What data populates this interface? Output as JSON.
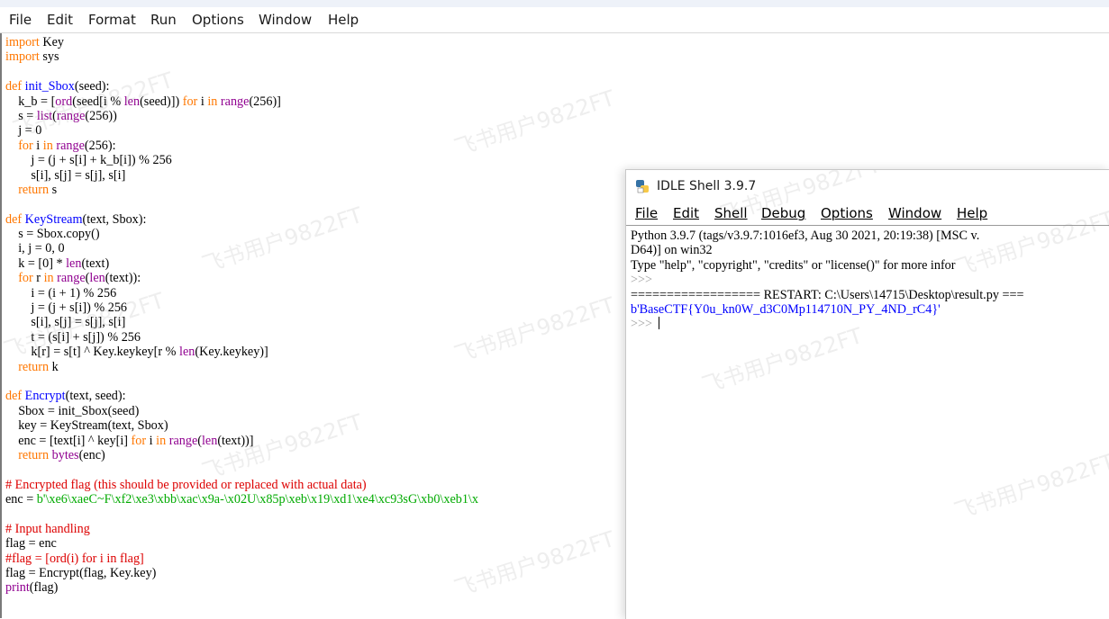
{
  "editor_menu": [
    "File",
    "Edit",
    "Format",
    "Run",
    "Options",
    "Window",
    "Help"
  ],
  "code_lines": [
    [
      [
        "kw",
        "import"
      ],
      [
        "p",
        " Key"
      ]
    ],
    [
      [
        "kw",
        "import"
      ],
      [
        "p",
        " sys"
      ]
    ],
    [],
    [
      [
        "kw",
        "def"
      ],
      [
        "p",
        " "
      ],
      [
        "fn",
        "init_Sbox"
      ],
      [
        "p",
        "(seed):"
      ]
    ],
    [
      [
        "p",
        "    k_b = ["
      ],
      [
        "bi",
        "ord"
      ],
      [
        "p",
        "(seed[i % "
      ],
      [
        "bi",
        "len"
      ],
      [
        "p",
        "(seed)]) "
      ],
      [
        "kw",
        "for"
      ],
      [
        "p",
        " i "
      ],
      [
        "kw",
        "in"
      ],
      [
        "p",
        " "
      ],
      [
        "bi",
        "range"
      ],
      [
        "p",
        "(256)]"
      ]
    ],
    [
      [
        "p",
        "    s = "
      ],
      [
        "bi",
        "list"
      ],
      [
        "p",
        "("
      ],
      [
        "bi",
        "range"
      ],
      [
        "p",
        "(256))"
      ]
    ],
    [
      [
        "p",
        "    j = 0"
      ]
    ],
    [
      [
        "p",
        "    "
      ],
      [
        "kw",
        "for"
      ],
      [
        "p",
        " i "
      ],
      [
        "kw",
        "in"
      ],
      [
        "p",
        " "
      ],
      [
        "bi",
        "range"
      ],
      [
        "p",
        "(256):"
      ]
    ],
    [
      [
        "p",
        "        j = (j + s[i] + k_b[i]) % 256"
      ]
    ],
    [
      [
        "p",
        "        s[i], s[j] = s[j], s[i]"
      ]
    ],
    [
      [
        "p",
        "    "
      ],
      [
        "kw",
        "return"
      ],
      [
        "p",
        " s"
      ]
    ],
    [],
    [
      [
        "kw",
        "def"
      ],
      [
        "p",
        " "
      ],
      [
        "fn",
        "KeyStream"
      ],
      [
        "p",
        "(text, Sbox):"
      ]
    ],
    [
      [
        "p",
        "    s = Sbox.copy()"
      ]
    ],
    [
      [
        "p",
        "    i, j = 0, 0"
      ]
    ],
    [
      [
        "p",
        "    k = [0] * "
      ],
      [
        "bi",
        "len"
      ],
      [
        "p",
        "(text)"
      ]
    ],
    [
      [
        "p",
        "    "
      ],
      [
        "kw",
        "for"
      ],
      [
        "p",
        " r "
      ],
      [
        "kw",
        "in"
      ],
      [
        "p",
        " "
      ],
      [
        "bi",
        "range"
      ],
      [
        "p",
        "("
      ],
      [
        "bi",
        "len"
      ],
      [
        "p",
        "(text)):"
      ]
    ],
    [
      [
        "p",
        "        i = (i + 1) % 256"
      ]
    ],
    [
      [
        "p",
        "        j = (j + s[i]) % 256"
      ]
    ],
    [
      [
        "p",
        "        s[i], s[j] = s[j], s[i]"
      ]
    ],
    [
      [
        "p",
        "        t = (s[i] + s[j]) % 256"
      ]
    ],
    [
      [
        "p",
        "        k[r] = s[t] ^ Key.keykey[r % "
      ],
      [
        "bi",
        "len"
      ],
      [
        "p",
        "(Key.keykey)]"
      ]
    ],
    [
      [
        "p",
        "    "
      ],
      [
        "kw",
        "return"
      ],
      [
        "p",
        " k"
      ]
    ],
    [],
    [
      [
        "kw",
        "def"
      ],
      [
        "p",
        " "
      ],
      [
        "fn",
        "Encrypt"
      ],
      [
        "p",
        "(text, seed):"
      ]
    ],
    [
      [
        "p",
        "    Sbox = init_Sbox(seed)"
      ]
    ],
    [
      [
        "p",
        "    key = KeyStream(text, Sbox)"
      ]
    ],
    [
      [
        "p",
        "    enc = [text[i] ^ key[i] "
      ],
      [
        "kw",
        "for"
      ],
      [
        "p",
        " i "
      ],
      [
        "kw",
        "in"
      ],
      [
        "p",
        " "
      ],
      [
        "bi",
        "range"
      ],
      [
        "p",
        "("
      ],
      [
        "bi",
        "len"
      ],
      [
        "p",
        "(text))]"
      ]
    ],
    [
      [
        "p",
        "    "
      ],
      [
        "kw",
        "return"
      ],
      [
        "p",
        " "
      ],
      [
        "bi",
        "bytes"
      ],
      [
        "p",
        "(enc)"
      ]
    ],
    [],
    [
      [
        "cm",
        "# Encrypted flag (this should be provided or replaced with actual data)"
      ]
    ],
    [
      [
        "p",
        "enc = "
      ],
      [
        "st",
        "b'\\xe6\\xaeC~F\\xf2\\xe3\\xbb\\xac\\x9a-\\x02U\\x85p\\xeb\\x19\\xd1\\xe4\\xc93sG\\xb0\\xeb1\\x"
      ]
    ],
    [],
    [
      [
        "cm",
        "# Input handling"
      ]
    ],
    [
      [
        "p",
        "flag = enc"
      ]
    ],
    [
      [
        "cm",
        "#flag = [ord(i) for i in flag]"
      ]
    ],
    [
      [
        "p",
        "flag = Encrypt(flag, Key.key)"
      ]
    ],
    [
      [
        "bi",
        "print"
      ],
      [
        "p",
        "(flag)"
      ]
    ]
  ],
  "watermark_text": "飞书用户9822FT",
  "shell": {
    "title": "IDLE Shell 3.9.7",
    "menu": [
      "File",
      "Edit",
      "Shell",
      "Debug",
      "Options",
      "Window",
      "Help"
    ],
    "lines": [
      [
        [
          "p",
          "Python 3.9.7 (tags/v3.9.7:1016ef3, Aug 30 2021, 20:19:38) [MSC v."
        ]
      ],
      [
        [
          "p",
          "D64)] on win32"
        ]
      ],
      [
        [
          "p",
          "Type \"help\", \"copyright\", \"credits\" or \"license()\" for more infor"
        ]
      ],
      [
        [
          "prompt",
          ">>> "
        ]
      ],
      [
        [
          "p",
          "================== RESTART: C:\\Users\\14715\\Desktop\\result.py ==="
        ]
      ],
      [
        [
          "res",
          "b'BaseCTF{Y0u_kn0W_d3C0Mp114710N_PY_4ND_rC4}'"
        ]
      ],
      [
        [
          "prompt",
          ">>> "
        ],
        [
          "caret",
          ""
        ]
      ]
    ]
  },
  "colors": {
    "keyword": "#ff7700",
    "builtin": "#900090",
    "defname": "#0000ff",
    "string": "#00aa00",
    "comment": "#dd0000",
    "output": "#0000ff"
  }
}
